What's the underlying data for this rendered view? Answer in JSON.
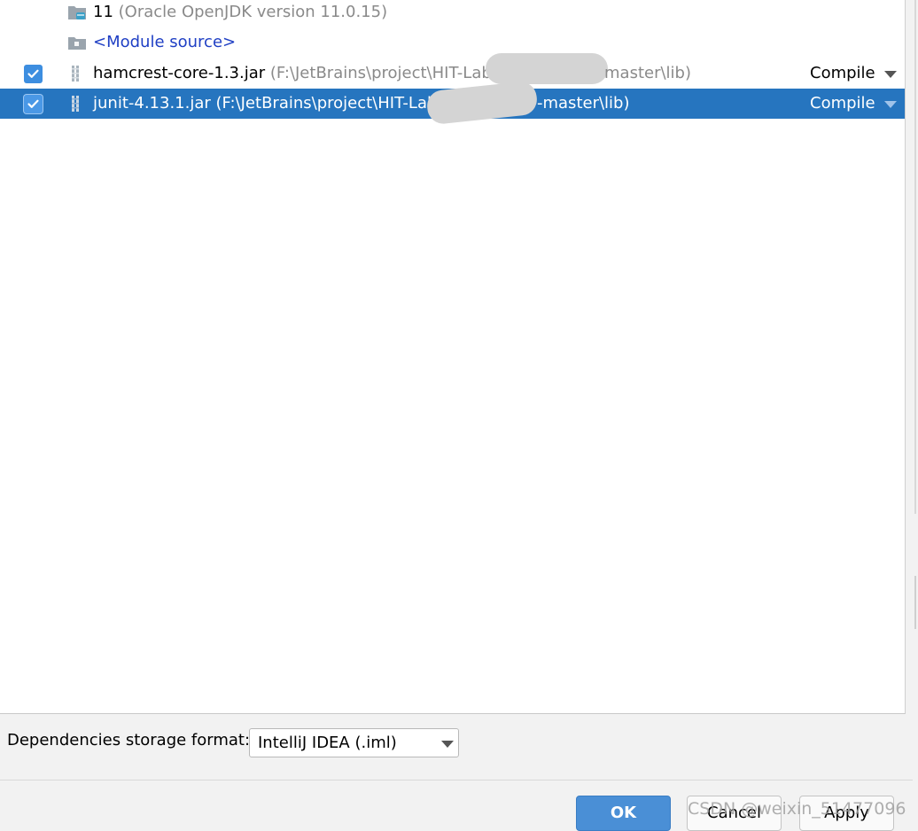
{
  "dependencies": {
    "rows": [
      {
        "name": "11",
        "detail": "(Oracle OpenJDK version 11.0.15)",
        "type": "sdk"
      },
      {
        "name": "<Module source>",
        "type": "module-source"
      },
      {
        "name": "hamcrest-core-1.3.jar",
        "detail": "(F:\\JetBrains\\project\\HIT-Lab1",
        "detail_tail": "master\\lib)",
        "checked": true,
        "scope": "Compile",
        "selected": false
      },
      {
        "name": "junit-4.13.1.jar",
        "detail": "(F:\\JetBrains\\project\\HIT-Lab",
        "detail_tail": "-master\\lib)",
        "checked": true,
        "scope": "Compile",
        "selected": true
      }
    ]
  },
  "storage": {
    "label": "Dependencies storage format:",
    "value": "IntelliJ IDEA (.iml)"
  },
  "buttons": {
    "ok": "OK",
    "cancel": "Cancel",
    "apply": "Apply"
  },
  "watermark": "CSDN @weixin_51477096",
  "colors": {
    "selection": "#2675bf",
    "checkbox": "#3d8ee0",
    "ok_button": "#4a8fd6",
    "link": "#1f3fc4"
  }
}
